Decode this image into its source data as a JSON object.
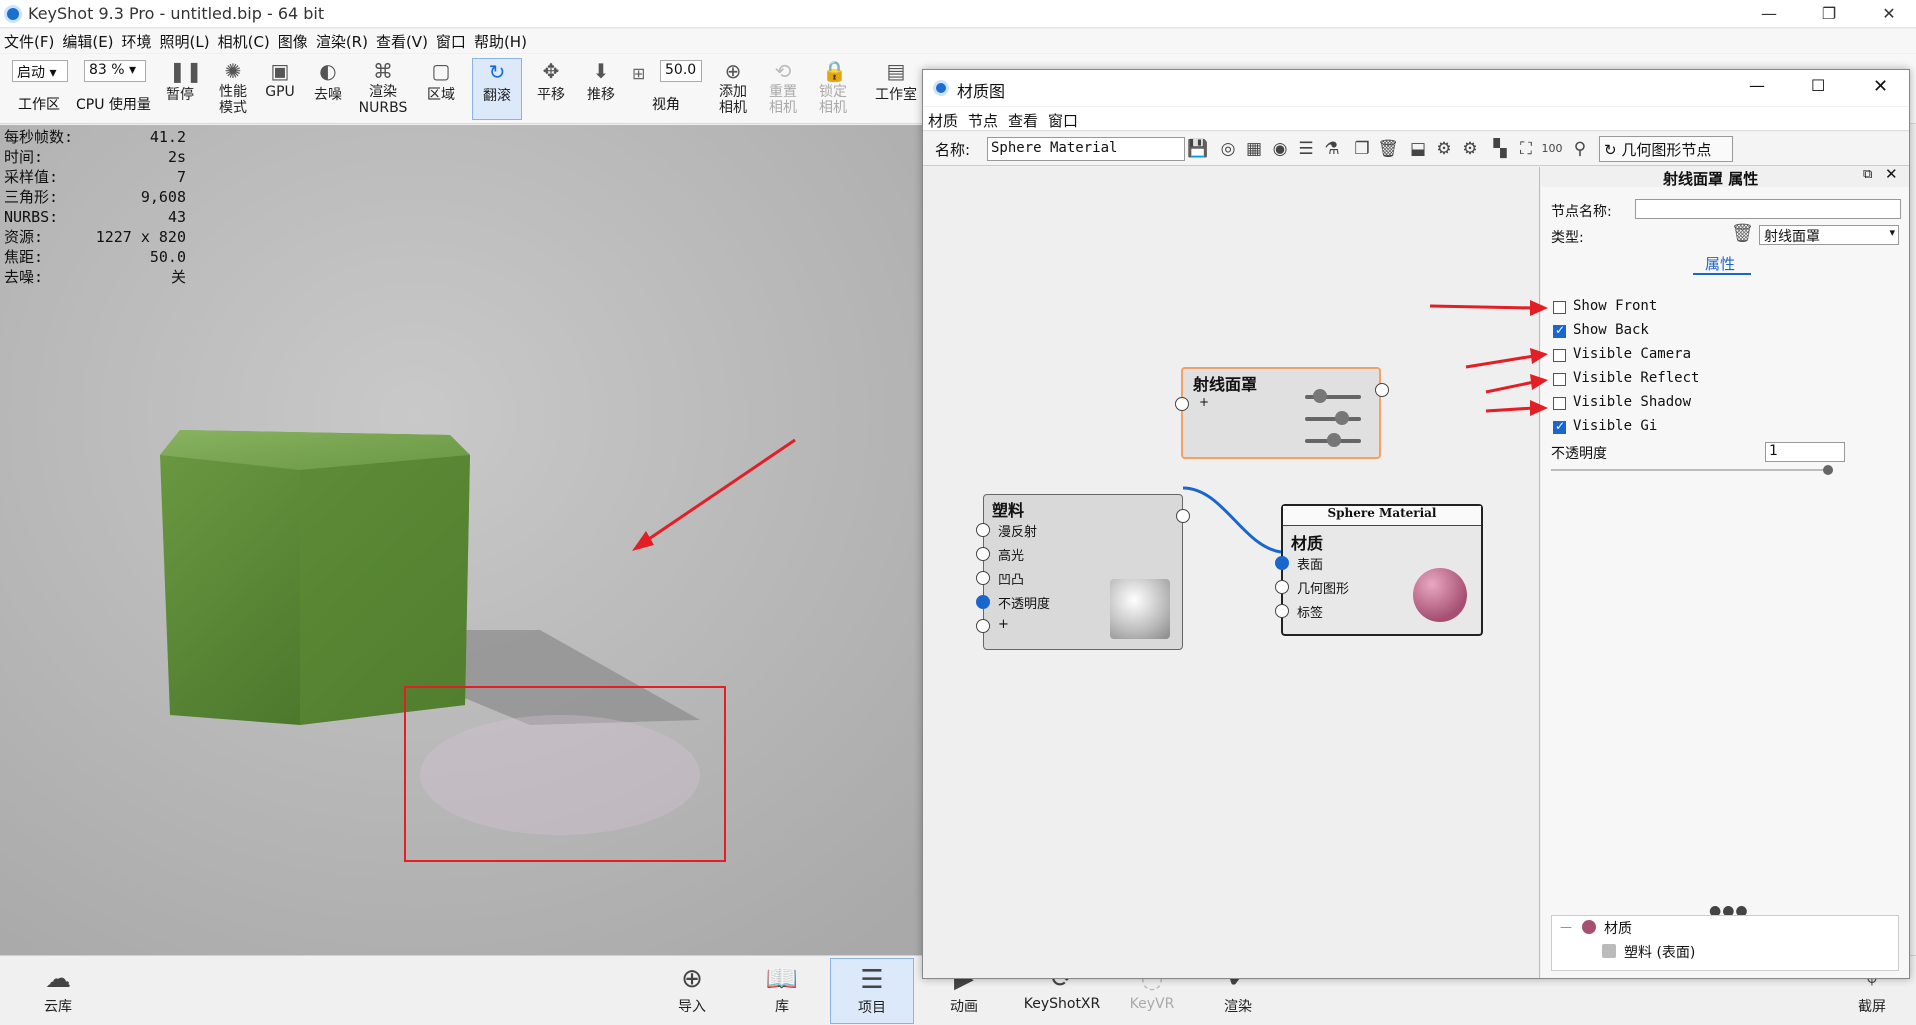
{
  "window": {
    "title": "KeyShot 9.3 Pro  - untitled.bip  - 64 bit"
  },
  "menu": [
    "文件(F)",
    "编辑(E)",
    "环境",
    "照明(L)",
    "相机(C)",
    "图像",
    "渲染(R)",
    "查看(V)",
    "窗口",
    "帮助(H)"
  ],
  "toolbar": {
    "workspace_select": "启动",
    "workspace_label": "工作区",
    "cpu_select": "83 %",
    "cpu_label": "CPU 使用量",
    "pause": "暂停",
    "perf": "性能\n模式",
    "gpu": "GPU",
    "denoise": "去噪",
    "nurbs": "渲染\nNURBS",
    "region": "区域",
    "tumble": "翻滚",
    "pan": "平移",
    "dolly": "推移",
    "fov_value": "50.0",
    "fov_label": "视角",
    "add_cam": "添加\n相机",
    "reset_cam": "重置\n相机",
    "lock_cam": "锁定\n相机",
    "studio": "工作室"
  },
  "stats": [
    {
      "k": "每秒帧数:",
      "v": "41.2"
    },
    {
      "k": "时间:",
      "v": "2s"
    },
    {
      "k": "采样值:",
      "v": "7"
    },
    {
      "k": "三角形:",
      "v": "9,608"
    },
    {
      "k": "NURBS:",
      "v": "43"
    },
    {
      "k": "资源:",
      "v": "1227 x 820"
    },
    {
      "k": "焦距:",
      "v": "50.0"
    },
    {
      "k": "去噪:",
      "v": "关"
    }
  ],
  "bottombar": {
    "cloud": "云库",
    "import": "导入",
    "library": "库",
    "project": "项目",
    "animation": "动画",
    "keyshotxr": "KeyShotXR",
    "keyvr": "KeyVR",
    "render": "渲染",
    "screenshot": "截屏"
  },
  "matwin": {
    "title": "材质图",
    "menu": [
      "材质",
      "节点",
      "查看",
      "窗口"
    ],
    "name_label": "名称:",
    "name_value": "Sphere Material",
    "geom_node_button": "几何图形节点"
  },
  "nodes": {
    "ray": {
      "title": "射线面罩",
      "plus": "+"
    },
    "plastic": {
      "title": "塑料",
      "ports": [
        "漫反射",
        "高光",
        "凹凸",
        "不透明度",
        "+"
      ]
    },
    "material": {
      "header": "Sphere Material",
      "title": "材质",
      "ports": [
        "表面",
        "几何图形",
        "标签"
      ]
    }
  },
  "props": {
    "title": "射线面罩  属性",
    "node_name_label": "节点名称:",
    "node_name_value": "",
    "type_label": "类型:",
    "type_value": "射线面罩",
    "tab": "属性",
    "checks": [
      {
        "label": "Show Front",
        "checked": false
      },
      {
        "label": "Show Back",
        "checked": true
      },
      {
        "label": "Visible Camera",
        "checked": false
      },
      {
        "label": "Visible Reflect",
        "checked": false
      },
      {
        "label": "Visible Shadow",
        "checked": false
      },
      {
        "label": "Visible Gi",
        "checked": true
      }
    ],
    "opacity_label": "不透明度",
    "opacity_value": "1",
    "opacity_level": 1.0,
    "tree_material": "材质",
    "tree_plastic": "塑料 (表面)"
  }
}
